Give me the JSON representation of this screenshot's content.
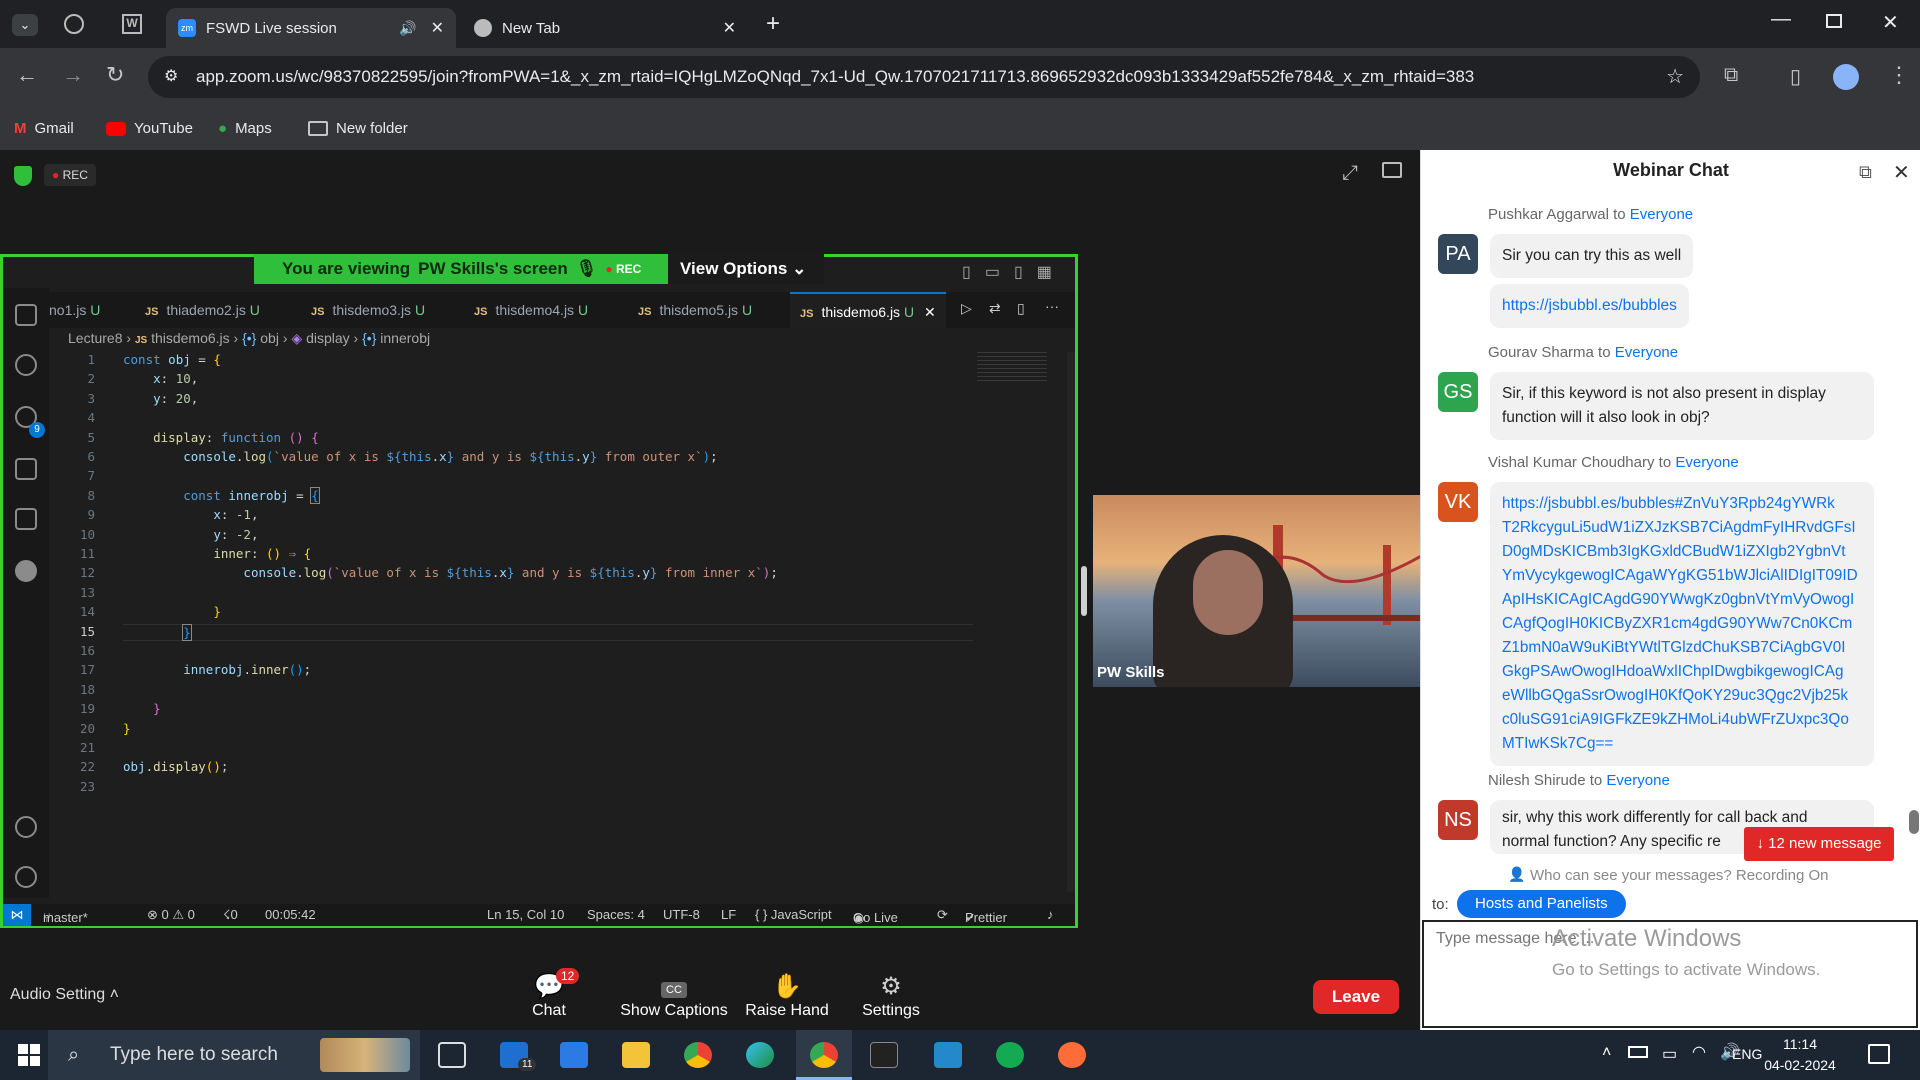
{
  "browser": {
    "tabs": [
      {
        "title": "FSWD Live session",
        "active": true
      },
      {
        "title": "New Tab",
        "active": false
      }
    ],
    "url": "app.zoom.us/wc/98370822595/join?fromPWA=1&_x_zm_rtaid=IQHgLMZoQNqd_7x1-Ud_Qw.1707021711713.869652932dc093b1333429af552fe784&_x_zm_rhtaid=383",
    "bookmarks": [
      "Gmail",
      "YouTube",
      "Maps",
      "New folder"
    ]
  },
  "zoom": {
    "rec": "REC",
    "viewing_prefix": "You are viewing",
    "viewing_name": "PW Skills's screen",
    "viewing_rec": "REC",
    "view_options": "View Options",
    "video_name": "PW Skills",
    "audio_setting": "Audio Setting",
    "toolbar": {
      "chat": "Chat",
      "chat_badge": "12",
      "captions": "Show Captions",
      "captions_icon": "CC",
      "raise_hand": "Raise Hand",
      "settings": "Settings"
    },
    "leave": "Leave"
  },
  "vscode": {
    "tabs": [
      {
        "name": "no1.js",
        "status": "U"
      },
      {
        "name": "thiademo2.js",
        "status": "U"
      },
      {
        "name": "thisdemo3.js",
        "status": "U"
      },
      {
        "name": "thisdemo4.js",
        "status": "U"
      },
      {
        "name": "thisdemo5.js",
        "status": "U"
      },
      {
        "name": "thisdemo6.js",
        "status": "U",
        "active": true
      }
    ],
    "breadcrumb": [
      "Lecture8",
      "thisdemo6.js",
      "obj",
      "display",
      "innerobj"
    ],
    "scm_badge": "9",
    "status": {
      "branch": "master*",
      "problems": "⊗ 0 ⚠ 0",
      "ports": "☇0",
      "time": "00:05:42",
      "position": "Ln 15, Col 10",
      "spaces": "Spaces: 4",
      "encoding": "UTF-8",
      "eol": "LF",
      "language": "{ } JavaScript",
      "golive": "Go Live",
      "prettier": "Prettier"
    },
    "line_numbers": [
      "1",
      "2",
      "3",
      "4",
      "5",
      "6",
      "7",
      "8",
      "9",
      "10",
      "11",
      "12",
      "13",
      "14",
      "15",
      "16",
      "17",
      "18",
      "19",
      "20",
      "21",
      "22",
      "23"
    ]
  },
  "chat": {
    "title": "Webinar Chat",
    "messages": [
      {
        "sender": "Pushkar Aggarwal",
        "to": "Everyone",
        "initials": "PA",
        "color": "#33475b",
        "lines": [
          "Sir you can try this as well"
        ],
        "link": "https://jsbubbl.es/bubbles"
      },
      {
        "sender": "Gourav Sharma",
        "to": "Everyone",
        "initials": "GS",
        "color": "#2ea44f",
        "lines": [
          "Sir, if this keyword is not also present in display",
          "function will it also look in obj?"
        ]
      },
      {
        "sender": "Vishal Kumar Choudhary",
        "to": "Everyone",
        "initials": "VK",
        "color": "#d9531e",
        "link_lines": [
          "https://jsbubbl.es/bubbles#ZnVuY3Rpb24gYWRk",
          "T2RkcyguLi5udW1iZXJzKSB7CiAgdmFyIHRvdGFsI",
          "D0gMDsKICBmb3IgKGxldCBudW1iZXIgb2YgbnVt",
          "YmVycykgewogICAgaWYgKG51bWJlciAlIDIgIT09ID",
          "ApIHsKICAgICAgdG90YWwgKz0gbnVtYmVyOwogI",
          "CAgfQogIH0KICByZXR1cm4gdG90YWw7Cn0KCm",
          "Z1bmN0aW9uKiBtYWtlTGlzdChuKSB7CiAgbGV0I",
          "GkgPSAwOwogIHdoaWxlIChpIDwgbikgewogICAg",
          "eWllbGQgaSsrOwogIH0KfQoKY29uc3Qgc2Vjb25k",
          "c0luSG91ciA9IGFkZE9kZHMoLi4ubWFrZUxpc3Qo",
          "MTIwKSk7Cg=="
        ]
      },
      {
        "sender": "Nilesh Shirude",
        "to": "Everyone",
        "initials": "NS",
        "color": "#c0392b",
        "lines": [
          "sir, why this work differently for call back and",
          "normal function? Any specific re"
        ]
      }
    ],
    "new_messages": "↓ 12 new message",
    "who_can_see": "Who can see your messages? Recording On",
    "to_label": "to:",
    "recipient": "Hosts and Panelists",
    "placeholder": "Type message here ...",
    "activate_title": "Activate Windows",
    "activate_sub": "Go to Settings to activate Windows."
  },
  "taskbar": {
    "search_placeholder": "Type here to search",
    "mail_badge": "11",
    "lang": "ENG",
    "time": "11:14",
    "date": "04-02-2024"
  }
}
